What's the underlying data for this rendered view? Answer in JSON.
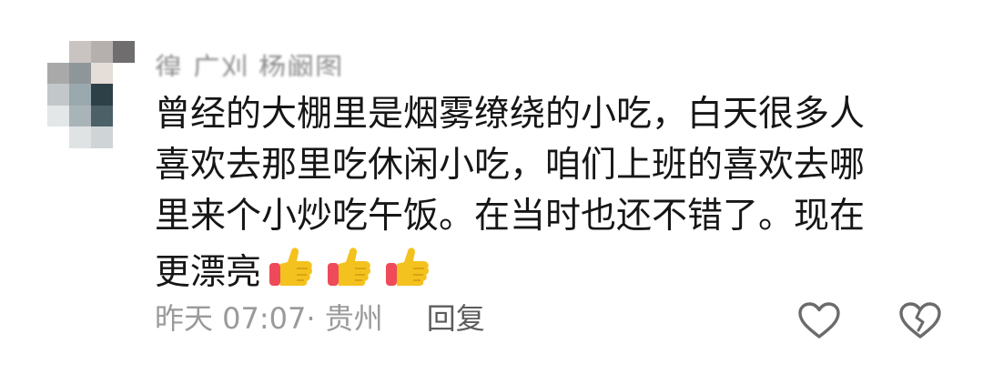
{
  "comment": {
    "username": "徨 广刈 杨阚图",
    "text_lines": [
      "曾经的大棚里是烟雾缭绕的小吃，白天很多人",
      "喜欢去那里吃休闲小吃，咱们上班的喜欢去哪",
      "里来个小炒吃午饭。在当时也还不错了。现在",
      "更漂亮"
    ],
    "emojis": [
      "thumbs-up-icon",
      "thumbs-up-icon",
      "thumbs-up-icon"
    ],
    "meta": {
      "time_location": "昨天 07:07· 贵州",
      "reply_label": "回复"
    },
    "actions": {
      "like_icon": "heart-outline-icon",
      "dislike_icon": "broken-heart-outline-icon"
    },
    "colors": {
      "text": "#161616",
      "meta": "#9a9a9a",
      "reply": "#5c5c5c",
      "icon": "#6b6b6b",
      "emoji_hand": "#f4c21e",
      "emoji_cuff": "#ee4a59"
    }
  }
}
